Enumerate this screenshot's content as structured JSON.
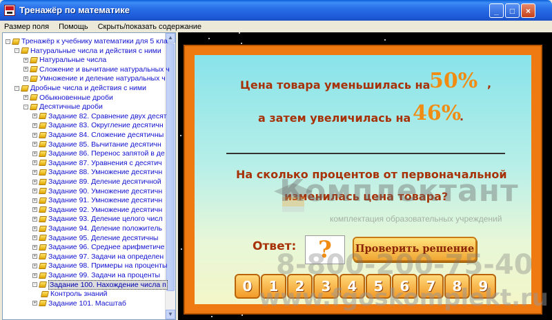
{
  "window": {
    "title": "Тренажёр по математике",
    "buttons": {
      "minimize": "_",
      "maximize": "□",
      "close": "×"
    }
  },
  "menu": [
    "Размер поля",
    "Помощь",
    "Скрыть/показать содержание"
  ],
  "tree": [
    {
      "label": "Тренажёр к учебнику математики для 5 кла",
      "level": 0,
      "expander": "-"
    },
    {
      "label": "Натуральные числа и действия с ними",
      "level": 1,
      "expander": "-"
    },
    {
      "label": "Натуральные числа",
      "level": 2,
      "expander": "+"
    },
    {
      "label": "Сложение и вычитание натуральных ч",
      "level": 2,
      "expander": "+"
    },
    {
      "label": "Умножение и деление натуральных ч",
      "level": 2,
      "expander": "+"
    },
    {
      "label": "Дробные числа и действия с ними",
      "level": 1,
      "expander": "-"
    },
    {
      "label": "Обыкновенные дроби",
      "level": 2,
      "expander": "+"
    },
    {
      "label": "Десятичные дроби",
      "level": 2,
      "expander": "-"
    },
    {
      "label": "Задание 82. Сравнение двух десят",
      "level": 3,
      "expander": "+"
    },
    {
      "label": "Задание 83. Округление десятичн",
      "level": 3,
      "expander": "+"
    },
    {
      "label": "Задание 84. Сложение десятичны",
      "level": 3,
      "expander": "+"
    },
    {
      "label": "Задание 85. Вычитание десятичн",
      "level": 3,
      "expander": "+"
    },
    {
      "label": "Задание 86. Перенос запятой в де",
      "level": 3,
      "expander": "+"
    },
    {
      "label": "Задание 87. Уравнения с десятич",
      "level": 3,
      "expander": "+"
    },
    {
      "label": "Задание 88. Умножение десятичн",
      "level": 3,
      "expander": "+"
    },
    {
      "label": "Задание 89. Деление десятичной",
      "level": 3,
      "expander": "+"
    },
    {
      "label": "Задание 90. Умножение десятичн",
      "level": 3,
      "expander": "+"
    },
    {
      "label": "Задание 91. Умножение десятичн",
      "level": 3,
      "expander": "+"
    },
    {
      "label": "Задание 92. Умножение десятичн",
      "level": 3,
      "expander": "+"
    },
    {
      "label": "Задание 93. Деление целого числ",
      "level": 3,
      "expander": "+"
    },
    {
      "label": "Задание 94. Деление положитель",
      "level": 3,
      "expander": "+"
    },
    {
      "label": "Задание 95. Деление десятичны",
      "level": 3,
      "expander": "+"
    },
    {
      "label": "Задание 96. Среднее арифметиче",
      "level": 3,
      "expander": "+"
    },
    {
      "label": "Задание 97. Задачи на определен",
      "level": 3,
      "expander": "+"
    },
    {
      "label": "Задание 98. Примеры на проценты",
      "level": 3,
      "expander": "+"
    },
    {
      "label": "Задание 99. Задачи на проценты",
      "level": 3,
      "expander": "+"
    },
    {
      "label": "Задание 100. Нахождение числа п",
      "level": 3,
      "expander": "-",
      "selected": true
    },
    {
      "label": "Контроль знаний",
      "level": 4,
      "expander": ""
    },
    {
      "label": "Задание 101. Масштаб",
      "level": 3,
      "expander": "+"
    }
  ],
  "task": {
    "line1_text": "Цена товара уменьшилась на",
    "line1_value": "50%",
    "line1_suffix": ",",
    "line2_text": "а затем увеличилась на",
    "line2_value": "46%",
    "line2_suffix": ".",
    "question_line1": "На сколько процентов от первоначальной",
    "question_line2": "изменилась цена товара?",
    "answer_label": "Ответ:",
    "answer_value": "?",
    "check_button": "Проверить решение",
    "digits": [
      "0",
      "1",
      "2",
      "3",
      "4",
      "5",
      "6",
      "7",
      "8",
      "9"
    ]
  },
  "watermark": {
    "brand": "Комплектант",
    "subtitle": "комплектация образовательных учреждений",
    "phone": "8-800-200-75-40",
    "url": "www.fgoskomplekt.ru"
  },
  "colors": {
    "title_bar": "#2A6FE8",
    "tree_text": "#1010d0",
    "task_text": "#a83208",
    "accent_numbers": "#f08c12",
    "frame": "#f07a12"
  }
}
